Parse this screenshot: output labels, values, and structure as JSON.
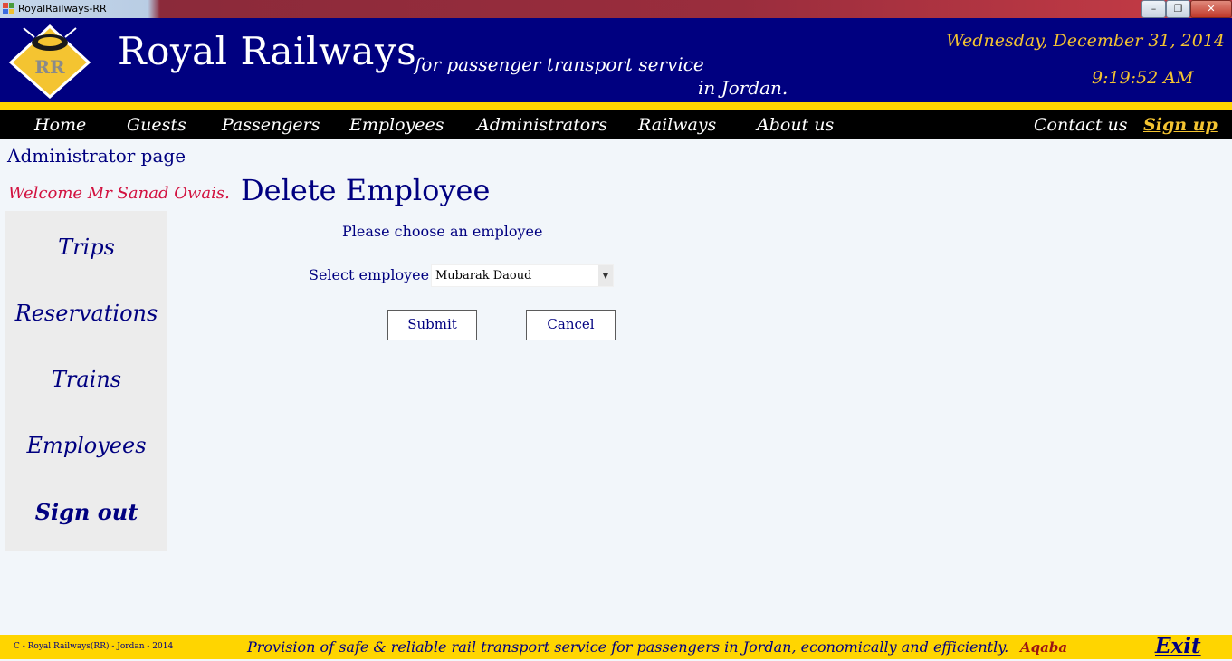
{
  "window": {
    "title": "RoyalRailways-RR",
    "min_glyph": "–",
    "max_glyph": "❐",
    "close_glyph": "✕"
  },
  "header": {
    "brand": "Royal Railways",
    "logo_text": "RR",
    "tagline_line1": "for passenger transport service",
    "tagline_line2": "in Jordan.",
    "date": "Wednesday, December 31, 2014",
    "time": "9:19:52 AM"
  },
  "nav": {
    "home": "Home",
    "guests": "Guests",
    "passengers": "Passengers",
    "employees": "Employees",
    "administrators": "Administrators",
    "railways": "Railways",
    "about": "About us",
    "contact": "Contact us",
    "signup": "Sign up"
  },
  "admin": {
    "page_label": "Administrator page",
    "welcome": "Welcome Mr Sanad Owais."
  },
  "sidebar": {
    "trips": "Trips",
    "reservations": "Reservations",
    "trains": "Trains",
    "employees": "Employees",
    "signout": "Sign out"
  },
  "form": {
    "title": "Delete Employee",
    "prompt": "Please choose an employee",
    "select_label": "Select employee",
    "selected_employee": "Mubarak Daoud",
    "submit": "Submit",
    "cancel": "Cancel"
  },
  "footer": {
    "copyright": "C - Royal Railways(RR) - Jordan - 2014",
    "mission": "Provision of safe & reliable rail transport service for passengers in Jordan, economically and efficiently.",
    "city": "Aqaba",
    "exit": "Exit"
  },
  "colors": {
    "navy": "#000080",
    "gold": "#ffd500",
    "gold_text": "#f4c431",
    "welcome_red": "#d2113f"
  }
}
